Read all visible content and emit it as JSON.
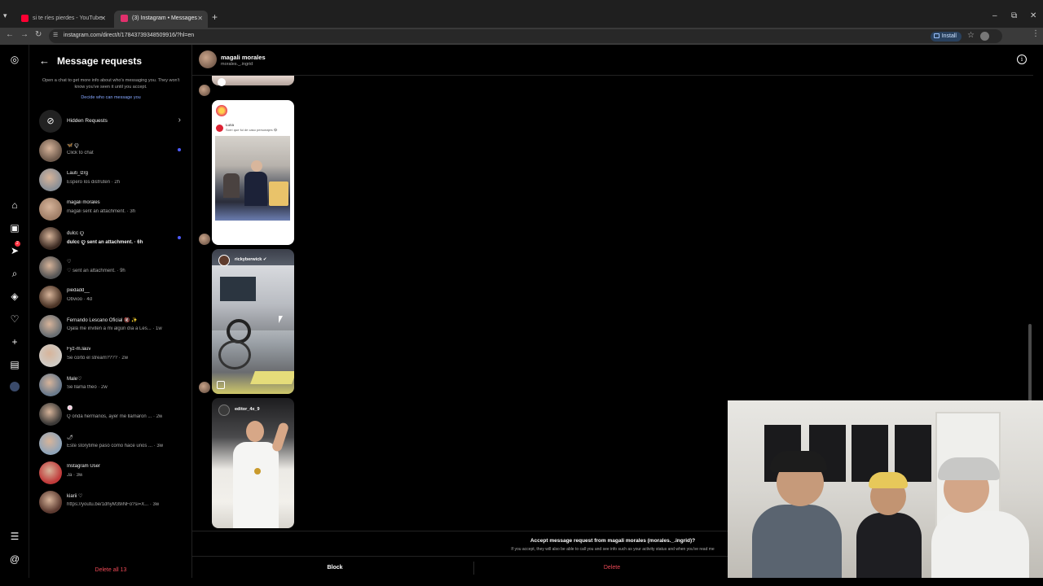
{
  "browser": {
    "tabs": [
      {
        "title": "si te ríes pierdes - YouTube",
        "favicon_color": "#ff0033",
        "active": false
      },
      {
        "title": "(3) Instagram • Messages",
        "favicon_color": "#e1306c",
        "active": true
      }
    ],
    "url": "instagram.com/direct/t/17843739348509916/?hl=en",
    "install_label": "Install"
  },
  "rail": {
    "icons": [
      "instagram-icon",
      "home-icon",
      "reels-icon",
      "messages-icon",
      "search-icon",
      "explore-icon",
      "notifications-icon",
      "create-icon",
      "dashboard-icon",
      "profile-icon",
      "menu-icon",
      "threads-icon"
    ],
    "messages_badge": "2"
  },
  "requests": {
    "title": "Message requests",
    "description": "Open a chat to get more info about who's messaging you. They won't know you've seen it until you accept.",
    "link": "Decide who can message you",
    "hidden_label": "Hidden Requests",
    "delete_all": "Delete all 13",
    "items": [
      {
        "name": "🦋 ꨄ",
        "preview": "Click to chat",
        "unread": true,
        "bold": false,
        "avatar": "#6e5a4c"
      },
      {
        "name": "Lauti_lzrg",
        "preview": "Espero los disfruten · 2h",
        "unread": false,
        "bold": false,
        "avatar": "#8a8f96"
      },
      {
        "name": "magali morales",
        "preview": "magali sent an attachment. · 3h",
        "unread": false,
        "bold": false,
        "avatar": "#a07f68"
      },
      {
        "name": "dulcc ꨄ",
        "preview": "dulcc ꨄ sent an attachment. · 6h",
        "unread": true,
        "bold": true,
        "avatar": "#3b2a22"
      },
      {
        "name": "♡",
        "preview": "♡ sent an attachment. · 9h",
        "unread": false,
        "bold": false,
        "avatar": "#555555"
      },
      {
        "name": "piedadd__",
        "preview": "Obvioo · 4d",
        "unread": false,
        "bold": false,
        "avatar": "#4b3426"
      },
      {
        "name": "Fernando Lescano Oficial 🔇 ✨",
        "preview": "Ojalá me inviten a mi algún día a Les... · 1w",
        "unread": false,
        "bold": false,
        "avatar": "#6a6f73"
      },
      {
        "name": "Fyz-m.lauv",
        "preview": "Se cortó el stream???? · 2w",
        "unread": false,
        "bold": false,
        "avatar": "#cfcac4"
      },
      {
        "name": "Male♡",
        "preview": "Se llama theo · 2w",
        "unread": false,
        "bold": false,
        "avatar": "#6a7a8c"
      },
      {
        "name": "🍥",
        "preview": "Q onda hermanos, ayer me llamaron ... · 2w",
        "unread": false,
        "bold": false,
        "avatar": "#3c3a38"
      },
      {
        "name": "🌶",
        "preview": "Este storytime pasó como hace unos ... · 3w",
        "unread": false,
        "bold": false,
        "avatar": "#8fa4b8"
      },
      {
        "name": "Instagram User",
        "preview": "Ja · 3w",
        "unread": false,
        "bold": false,
        "avatar": "#c03a3a"
      },
      {
        "name": "kiarii ♡",
        "preview": "https://youtu.be/1dhyM39iNFo?si=X... · 3w",
        "unread": false,
        "bold": false,
        "avatar": "#5c3a30"
      }
    ]
  },
  "chat": {
    "name": "magali morales",
    "username": "morales._.ingrid",
    "posts": [
      {
        "handle": "",
        "caption_name": "Luna",
        "caption_text": "Sorrí que fui de caso personajes 😂"
      },
      {
        "handle": "rickyberwick ✔"
      },
      {
        "handle": "editor_4x_9"
      }
    ],
    "accept_title": "Accept message request from magali morales (morales._.ingrid)?",
    "accept_desc": "If you accept, they will also be able to call you and see info such as your activity status and when you've read me",
    "block_label": "Block",
    "delete_label": "Delete"
  }
}
